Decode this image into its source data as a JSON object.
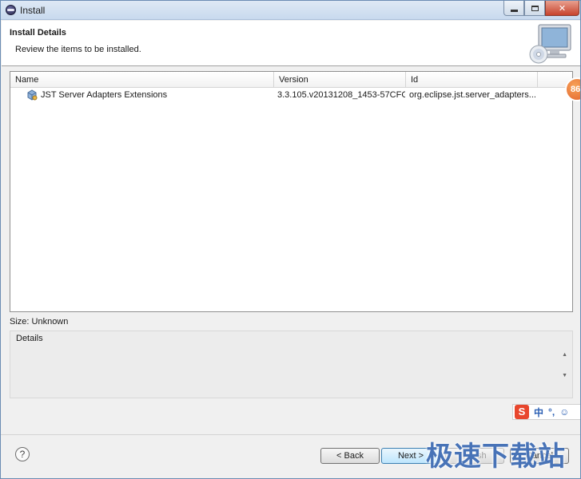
{
  "window": {
    "title": "Install",
    "controls": {
      "minimize": "",
      "maximize": "",
      "close": "✕"
    }
  },
  "banner": {
    "heading": "Install Details",
    "subheading": "Review the items to be installed.",
    "icon": "computer-cd-icon"
  },
  "table": {
    "columns": {
      "name": "Name",
      "version": "Version",
      "id": "Id"
    },
    "rows": [
      {
        "name": "JST Server Adapters Extensions",
        "version": "3.3.105.v20131208_1453-57CFG...",
        "id": "org.eclipse.jst.server_adapters....",
        "icon": "plugin-feature-icon"
      }
    ]
  },
  "size_label": "Size: Unknown",
  "details": {
    "label": "Details",
    "text": ""
  },
  "buttons": {
    "help": "?",
    "back": "< Back",
    "next": "Next >",
    "finish": "Finish",
    "cancel": "Cancel"
  },
  "overlays": {
    "badge": "86",
    "ime": {
      "logo": "S",
      "mode": "中",
      "punct": "°,",
      "emoji": "☺",
      "mic": "🎙"
    },
    "watermark": "极速下载站"
  },
  "colors": {
    "accent": "#3c7fb1",
    "close": "#c7432d",
    "badge": "#e2612a",
    "watermark": "#285aaa"
  }
}
